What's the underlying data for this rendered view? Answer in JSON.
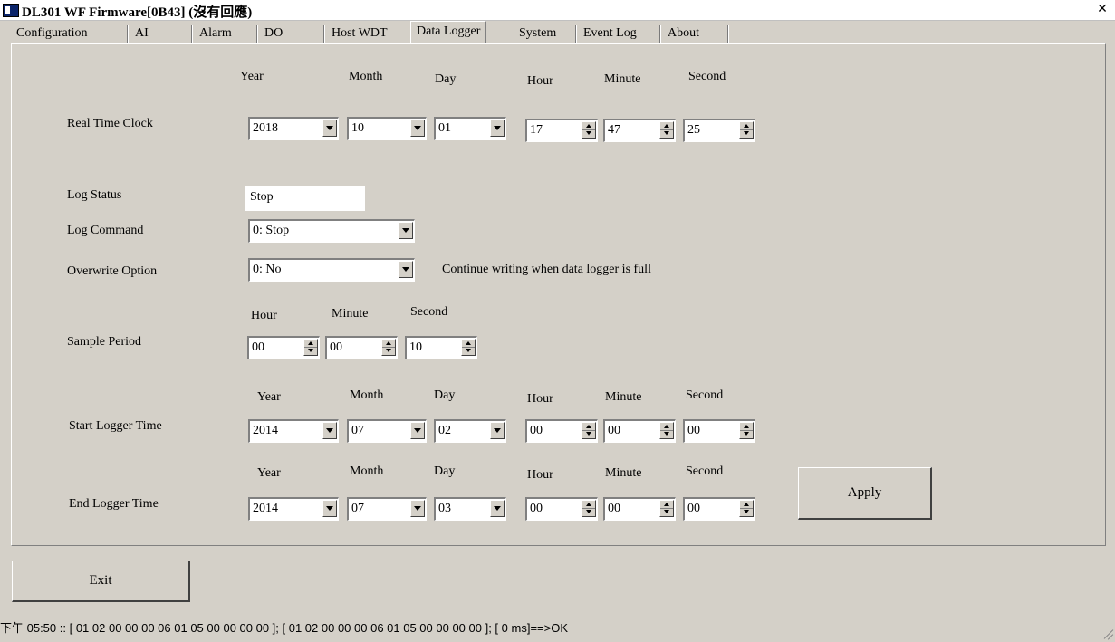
{
  "window": {
    "title": "DL301 WF Firmware[0B43] (沒有回應)"
  },
  "tabs": [
    {
      "label": "Configuration"
    },
    {
      "label": "AI"
    },
    {
      "label": "Alarm"
    },
    {
      "label": "DO"
    },
    {
      "label": "Host WDT"
    },
    {
      "label": "Data Logger",
      "active": true
    },
    {
      "label": "System"
    },
    {
      "label": "Event Log"
    },
    {
      "label": "About"
    }
  ],
  "headers": {
    "year": "Year",
    "month": "Month",
    "day": "Day",
    "hour": "Hour",
    "minute": "Minute",
    "second": "Second"
  },
  "rtc": {
    "label": "Real Time Clock",
    "year": "2018",
    "month": "10",
    "day": "01",
    "hour": "17",
    "minute": "47",
    "second": "25"
  },
  "log_status": {
    "label": "Log Status",
    "value": "Stop"
  },
  "log_command": {
    "label": "Log Command",
    "value": "0: Stop"
  },
  "overwrite": {
    "label": "Overwrite Option",
    "value": "0: No",
    "note": "Continue writing when data logger is full"
  },
  "sample_period": {
    "label": "Sample Period",
    "hour": "00",
    "minute": "00",
    "second": "10"
  },
  "start_time": {
    "label": "Start Logger Time",
    "year": "2014",
    "month": "07",
    "day": "02",
    "hour": "00",
    "minute": "00",
    "second": "00"
  },
  "end_time": {
    "label": "End Logger Time",
    "year": "2014",
    "month": "07",
    "day": "03",
    "hour": "00",
    "minute": "00",
    "second": "00"
  },
  "buttons": {
    "apply": "Apply",
    "exit": "Exit"
  },
  "status_line": "下午 05:50 :: [ 01 02 00 00 00 06 01 05 00 00 00 00 ]; [ 01 02 00 00 00 06 01 05 00 00 00 00 ]; [ 0 ms]==>OK"
}
